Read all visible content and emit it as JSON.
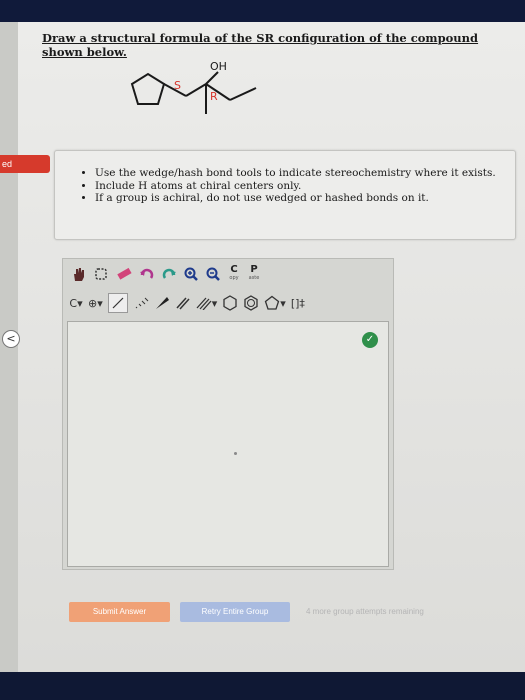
{
  "question": {
    "text": "Draw a structural formula of the SR configuration of the compound shown below."
  },
  "molecule": {
    "oh_label": "OH",
    "s_label": "S",
    "r_label": "R",
    "colors": {
      "stereo_label": "#d6332a",
      "bond": "#1a1a1a"
    }
  },
  "side": {
    "tab_label": "ed",
    "collapse_glyph": "<"
  },
  "hints": [
    "Use the wedge/hash bond tools to indicate stereochemistry where it exists.",
    "Include H atoms at chiral centers only.",
    "If a group is achiral, do not use wedged or hashed bonds on it."
  ],
  "toolbar": {
    "copy_main": "C",
    "copy_sub": "opy",
    "paste_main": "P",
    "paste_sub": "aste",
    "element_label": "C",
    "charge_label": "⊕",
    "dropdown_glyph": "▾",
    "bracket_label": "[]‡"
  },
  "canvas": {
    "check_glyph": "✓"
  },
  "actions": {
    "submit_label": "Submit Answer",
    "retry_label": "Retry Entire Group",
    "attempts_text": "4 more group attempts remaining"
  }
}
